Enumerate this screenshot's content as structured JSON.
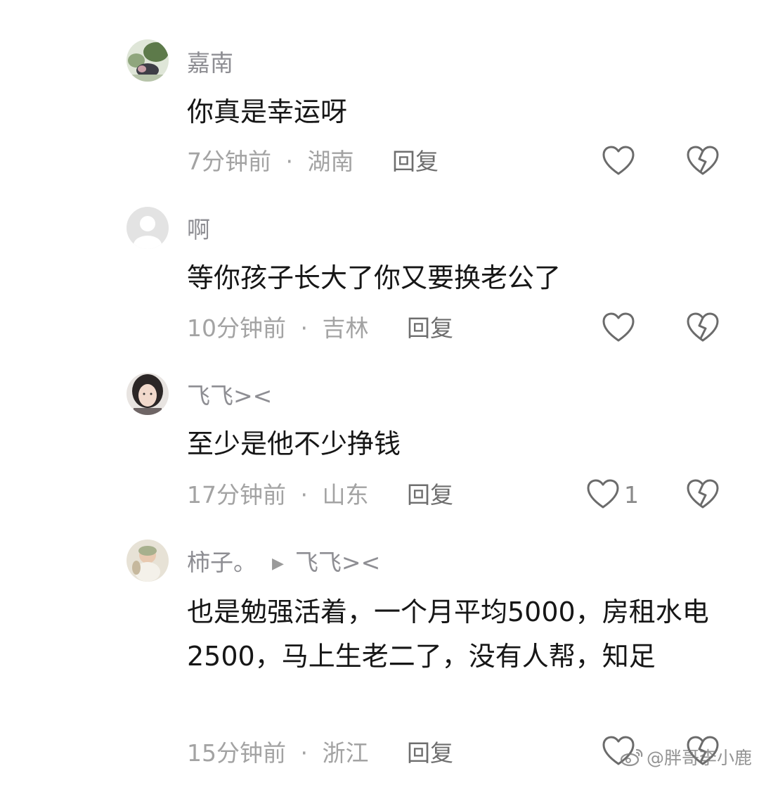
{
  "comments": [
    {
      "username": "嘉南",
      "text": "你真是幸运呀",
      "time": "7分钟前",
      "separator": "·",
      "location": "湖南",
      "reply_label": "回复",
      "like_count": ""
    },
    {
      "username": "啊",
      "text": "等你孩子长大了你又要换老公了",
      "time": "10分钟前",
      "separator": "·",
      "location": "吉林",
      "reply_label": "回复",
      "like_count": ""
    },
    {
      "username": "飞飞><",
      "text": "至少是他不少挣钱",
      "time": "17分钟前",
      "separator": "·",
      "location": "山东",
      "reply_label": "回复",
      "like_count": "1"
    },
    {
      "username": "柿子。",
      "reply_to": "飞飞><",
      "text": "也是勉强活着，一个月平均5000，房租水电2500，马上生老二了，没有人帮，知足",
      "time": "15分钟前",
      "separator": "·",
      "location": "浙江",
      "reply_label": "回复",
      "like_count": ""
    }
  ],
  "watermark": {
    "text": "@胖哥李小鹿",
    "logo_icon": "weibo-logo-icon"
  },
  "colors": {
    "username": "#8e8e93",
    "body_text": "#161616",
    "meta": "#a3a3a3",
    "reply": "#6e6e6e",
    "icon_stroke": "#6b6b6b"
  }
}
